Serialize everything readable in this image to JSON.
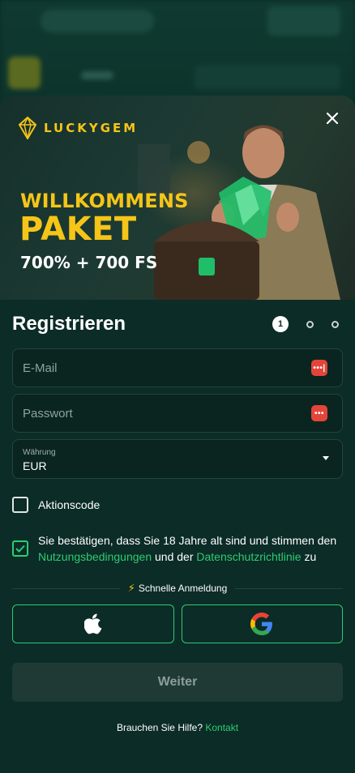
{
  "brand": {
    "name": "LUCKYGEM"
  },
  "banner": {
    "line1": "WILLKOMMENS",
    "line2": "PAKET",
    "line3": "700% + 700 FS"
  },
  "form": {
    "title": "Registrieren",
    "current_step": "1",
    "email_placeholder": "E-Mail",
    "password_placeholder": "Passwort",
    "currency_label": "Währung",
    "currency_value": "EUR",
    "promo_label": "Aktionscode",
    "terms": {
      "part1": "Sie bestätigen, dass Sie 18 Jahre alt sind und stimmen den ",
      "link1": "Nutzungsbedingungen",
      "part2": " und der ",
      "link2": "Datenschutzrichtlinie",
      "part3": " zu"
    },
    "quick_login": "Schnelle Anmeldung",
    "continue_label": "Weiter",
    "help_text": "Brauchen Sie Hilfe?",
    "help_link": "Kontakt"
  },
  "colors": {
    "accent": "#2ecc71",
    "brand_yellow": "#f5c518",
    "background": "#0b2c27"
  },
  "icons": [
    "close-icon",
    "gem-logo-icon",
    "password-manager-icon",
    "chevron-down-icon",
    "checkmark-icon",
    "lightning-icon",
    "apple-icon",
    "google-icon"
  ]
}
